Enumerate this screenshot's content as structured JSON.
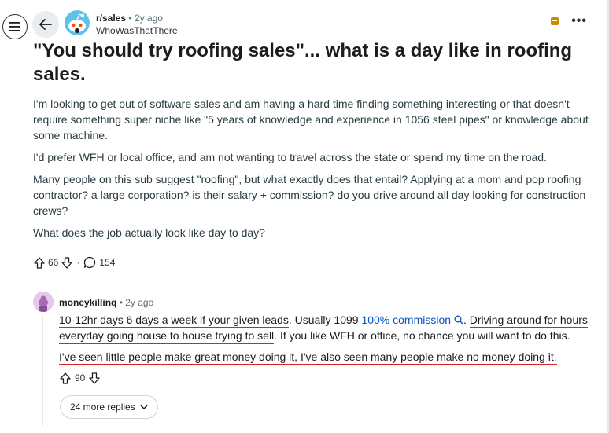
{
  "header": {
    "subreddit": "r/sales",
    "dot": "•",
    "post_age": "2y ago",
    "author": "WhoWasThatThere",
    "more_label": "•••"
  },
  "post": {
    "title": "\"You should try roofing sales\"... what is a day like in roofing sales.",
    "paragraphs": [
      "I'm looking to get out of software sales and am having a hard time finding something interesting or that doesn't require something super niche like \"5 years of knowledge and experience in 1056 steel pipes\" or knowledge about some machine.",
      "I'd prefer WFH or local office, and am not wanting to travel across the state or spend my time on the road.",
      "Many people on this sub suggest \"roofing\", but what exactly does that entail? Applying at a mom and pop roofing contractor? a large corporation? is their salary + commission? do you drive around all day looking for construction crews?",
      "What does the job actually look like day to day?"
    ],
    "upvotes": "66",
    "comments": "154",
    "sep": "·"
  },
  "comment": {
    "author": "moneykillinq",
    "dot": "•",
    "age": "2y ago",
    "p1_a": "10-12hr days 6 days a week if your given leads",
    "p1_b": ". Usually 1099 ",
    "p1_link": "100% commission",
    "p1_c": ". ",
    "p1_d": "Driving around for hours everyday going house to house trying to sell",
    "p1_e": ". If you like WFH or office, no chance you will want to do this.",
    "p2": "I've seen little people make great money doing it, I've also seen many people make no money doing it.",
    "upvotes": "90",
    "more_replies": "24 more replies"
  },
  "colors": {
    "accent_link": "#0a55c6",
    "underline_red": "#d8222a",
    "award": "#c98a00"
  }
}
